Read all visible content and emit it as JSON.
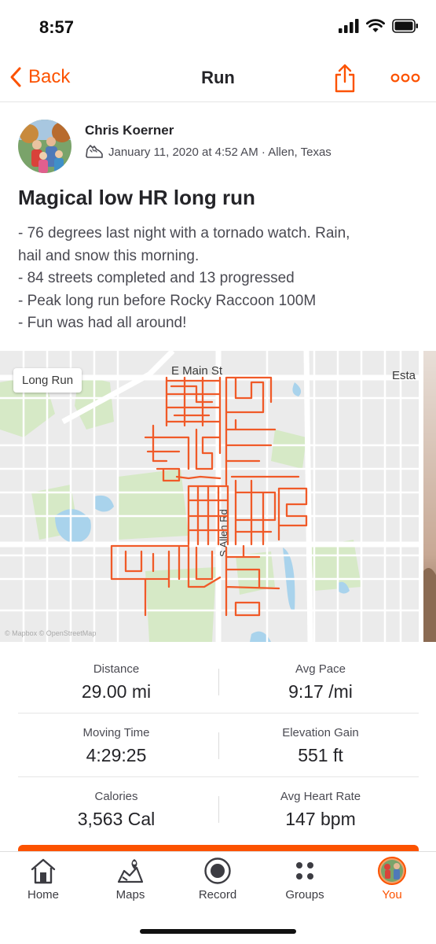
{
  "status_bar": {
    "time": "8:57"
  },
  "nav": {
    "back_label": "Back",
    "title": "Run"
  },
  "athlete": {
    "name": "Chris Koerner",
    "meta": "January 11, 2020 at 4:52 AM · Allen, Texas"
  },
  "activity": {
    "title": "Magical low HR long run",
    "description_lines": [
      "- 76 degrees last night with a tornado watch. Rain,",
      "hail and snow this morning.",
      "- 84 streets completed and 13 progressed",
      "- Peak long run before Rocky Raccoon 100M",
      "- Fun was had all around!"
    ]
  },
  "map": {
    "tag": "Long Run",
    "street_labels": [
      "E Main St",
      "Esta"
    ],
    "vertical_street_label": "S Allen Rd",
    "attribution": "© Mapbox © OpenStreetMap",
    "route_color": "#f05a28"
  },
  "stats": [
    {
      "left": {
        "label": "Distance",
        "value": "29.00 mi"
      },
      "right": {
        "label": "Avg Pace",
        "value": "9:17 /mi"
      }
    },
    {
      "left": {
        "label": "Moving Time",
        "value": "4:29:25"
      },
      "right": {
        "label": "Elevation Gain",
        "value": "551 ft"
      }
    },
    {
      "left": {
        "label": "Calories",
        "value": "3,563 Cal"
      },
      "right": {
        "label": "Avg Heart Rate",
        "value": "147 bpm"
      }
    }
  ],
  "tabs": [
    {
      "label": "Home",
      "icon": "home-icon",
      "active": false
    },
    {
      "label": "Maps",
      "icon": "map-pin-icon",
      "active": false
    },
    {
      "label": "Record",
      "icon": "record-icon",
      "active": false
    },
    {
      "label": "Groups",
      "icon": "groups-icon",
      "active": false
    },
    {
      "label": "You",
      "icon": "avatar",
      "active": true
    }
  ],
  "colors": {
    "accent": "#fc5200",
    "text": "#242428",
    "muted": "#4a4a52"
  }
}
